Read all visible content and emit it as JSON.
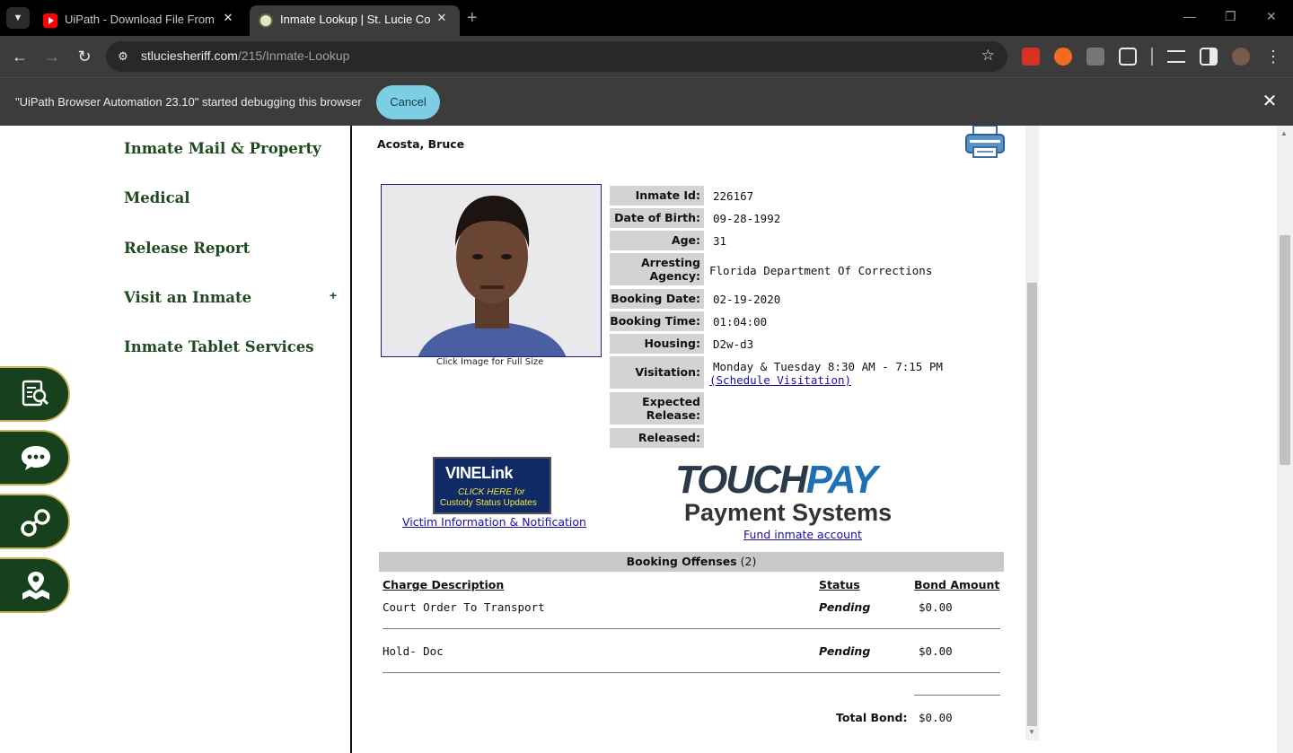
{
  "browser": {
    "tabs": [
      {
        "title": "UiPath - Download File From UI",
        "active": false
      },
      {
        "title": "Inmate Lookup | St. Lucie Co Sh",
        "active": true
      }
    ],
    "url_host": "stluciesheriff.com",
    "url_path": "/215/Inmate-Lookup",
    "debug_message": "\"UiPath Browser Automation 23.10\" started debugging this browser",
    "debug_cancel": "Cancel",
    "colors": {
      "tabbar": "#000000",
      "toolbar": "#3c3c3c",
      "cancel": "#7ccfe3"
    }
  },
  "sidebar": {
    "items": [
      {
        "label": "Inmate Mail & Property"
      },
      {
        "label": "Medical"
      },
      {
        "label": "Release Report"
      },
      {
        "label": "Visit an Inmate",
        "expand": "+"
      },
      {
        "label": "Inmate Tablet Services"
      }
    ],
    "float_buttons": [
      "document-search-icon",
      "chat-icon",
      "handcuffs-icon",
      "map-pin-icon"
    ],
    "colors": {
      "green": "#17401c",
      "gold": "#c9b35a"
    }
  },
  "inmate": {
    "name": "Acosta, Bruce",
    "photo_caption": "Click Image for Full Size",
    "fields": [
      {
        "label": "Inmate Id:",
        "value": "226167"
      },
      {
        "label": "Date of Birth:",
        "value": "09-28-1992"
      },
      {
        "label": "Age:",
        "value": "31"
      },
      {
        "label": "Arresting Agency:",
        "value": "Florida Department Of Corrections"
      },
      {
        "label": "Booking Date:",
        "value": "02-19-2020"
      },
      {
        "label": "Booking Time:",
        "value": "01:04:00"
      },
      {
        "label": "Housing:",
        "value": "D2w-d3"
      },
      {
        "label": "Visitation:",
        "value": "Monday & Tuesday 8:30 AM - 7:15 PM"
      },
      {
        "label": "Expected Release:",
        "value": ""
      },
      {
        "label": "Released:",
        "value": ""
      }
    ],
    "schedule_link": "(Schedule Visitation)"
  },
  "vine": {
    "logo": "VINELink",
    "line1": "CLICK HERE for",
    "line2": "Custody Status Updates",
    "link": "Victim Information & Notification"
  },
  "touchpay": {
    "logo_a": "TOUCH",
    "logo_b": "PAY",
    "subtitle": "Payment Systems",
    "link": "Fund inmate account"
  },
  "offenses": {
    "heading": "Booking Offenses",
    "count": "(2)",
    "columns": [
      "Charge Description",
      "Status",
      "Bond Amount"
    ],
    "rows": [
      {
        "charge": "Court Order To Transport",
        "status": "Pending",
        "bond": "$0.00"
      },
      {
        "charge": "Hold- Doc",
        "status": "Pending",
        "bond": "$0.00"
      }
    ],
    "total_label": "Total Bond:",
    "total_value": "$0.00"
  }
}
